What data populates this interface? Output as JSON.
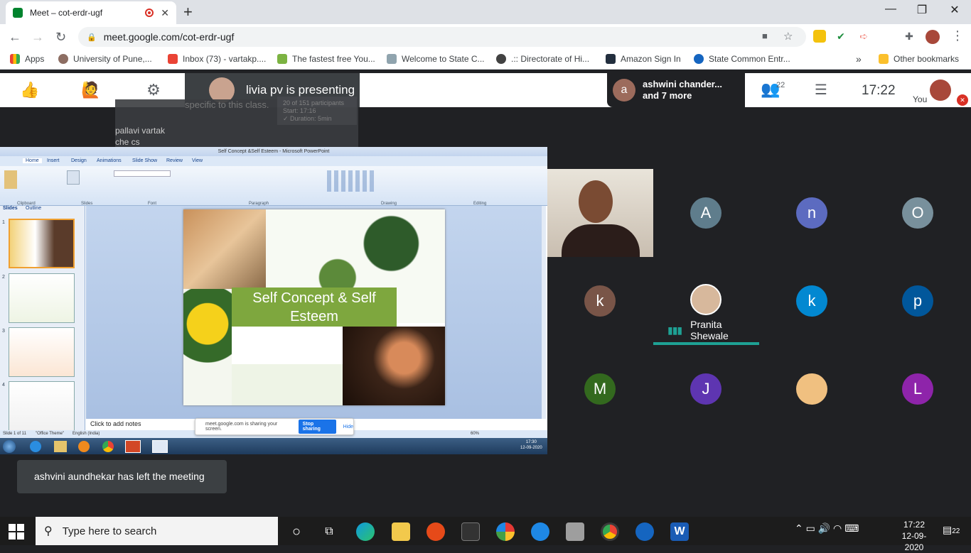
{
  "browser": {
    "tab_title": "Meet – cot-erdr-ugf",
    "url": "meet.google.com/cot-erdr-ugf",
    "bookmarks": [
      "Apps",
      "University of Pune,...",
      "Inbox (73) - vartakp....",
      "The fastest free You...",
      "Welcome to State C...",
      ".:: Directorate of Hi...",
      "Amazon Sign In",
      "State Common Entr...",
      "Other bookmarks"
    ]
  },
  "meet": {
    "presenting_text": "livia pv is presenting",
    "pill_initial": "a",
    "pill_line1": "ashwini chander...",
    "pill_line2": "and 7 more",
    "people_count": "22",
    "time": "17:22",
    "you_label": "You",
    "toast": "ashvini aundhekar has left the meeting",
    "speaker_name": "Pranita Shewale",
    "participants": [
      {
        "initial": "A",
        "color": "#5f7d8c"
      },
      {
        "initial": "n",
        "color": "#5c6bc0"
      },
      {
        "initial": "O",
        "color": "#78909c"
      },
      {
        "initial": "k",
        "color": "#795548"
      },
      {
        "initial": "k",
        "color": "#0288d1"
      },
      {
        "initial": "p",
        "color": "#01579b"
      },
      {
        "initial": "M",
        "color": "#33691e"
      },
      {
        "initial": "J",
        "color": "#5e35b1"
      },
      {
        "initial": "L",
        "color": "#8e24aa"
      }
    ],
    "ghost_text_1": "specific to this class.",
    "ghost_text_2": "20 of 151 participants",
    "ghost_text_3": "Start: 17:16",
    "ghost_text_4": "✓ Duration: 5min",
    "ghost_names_1": "pallavi vartak",
    "ghost_names_2": "che cs"
  },
  "shared_screen": {
    "window_title": "Self Concept &Self Esteem - Microsoft PowerPoint",
    "tabs": [
      "Home",
      "Insert",
      "Design",
      "Animations",
      "Slide Show",
      "Review",
      "View"
    ],
    "ribbon_groups": [
      "Clipboard",
      "Slides",
      "Font",
      "Paragraph",
      "Drawing",
      "Editing"
    ],
    "pane_tabs": [
      "Slides",
      "Outline"
    ],
    "thumb_numbers": [
      "1",
      "2",
      "3",
      "4"
    ],
    "slide_title": "Self Concept & Self Esteem",
    "notes_placeholder": "Click to add notes",
    "status_slide": "Slide 1 of 11",
    "status_theme": "\"Office Theme\"",
    "status_lang": "English (India)",
    "zoom": "60%",
    "share_text": "meet.google.com is sharing your screen.",
    "share_stop": "Stop sharing",
    "share_hide": "Hide",
    "inner_clock_time": "17:30",
    "inner_clock_date": "12-09-2020"
  },
  "taskbar": {
    "search_placeholder": "Type here to search",
    "time": "17:22",
    "date": "12-09-2020",
    "notifications": "22"
  }
}
